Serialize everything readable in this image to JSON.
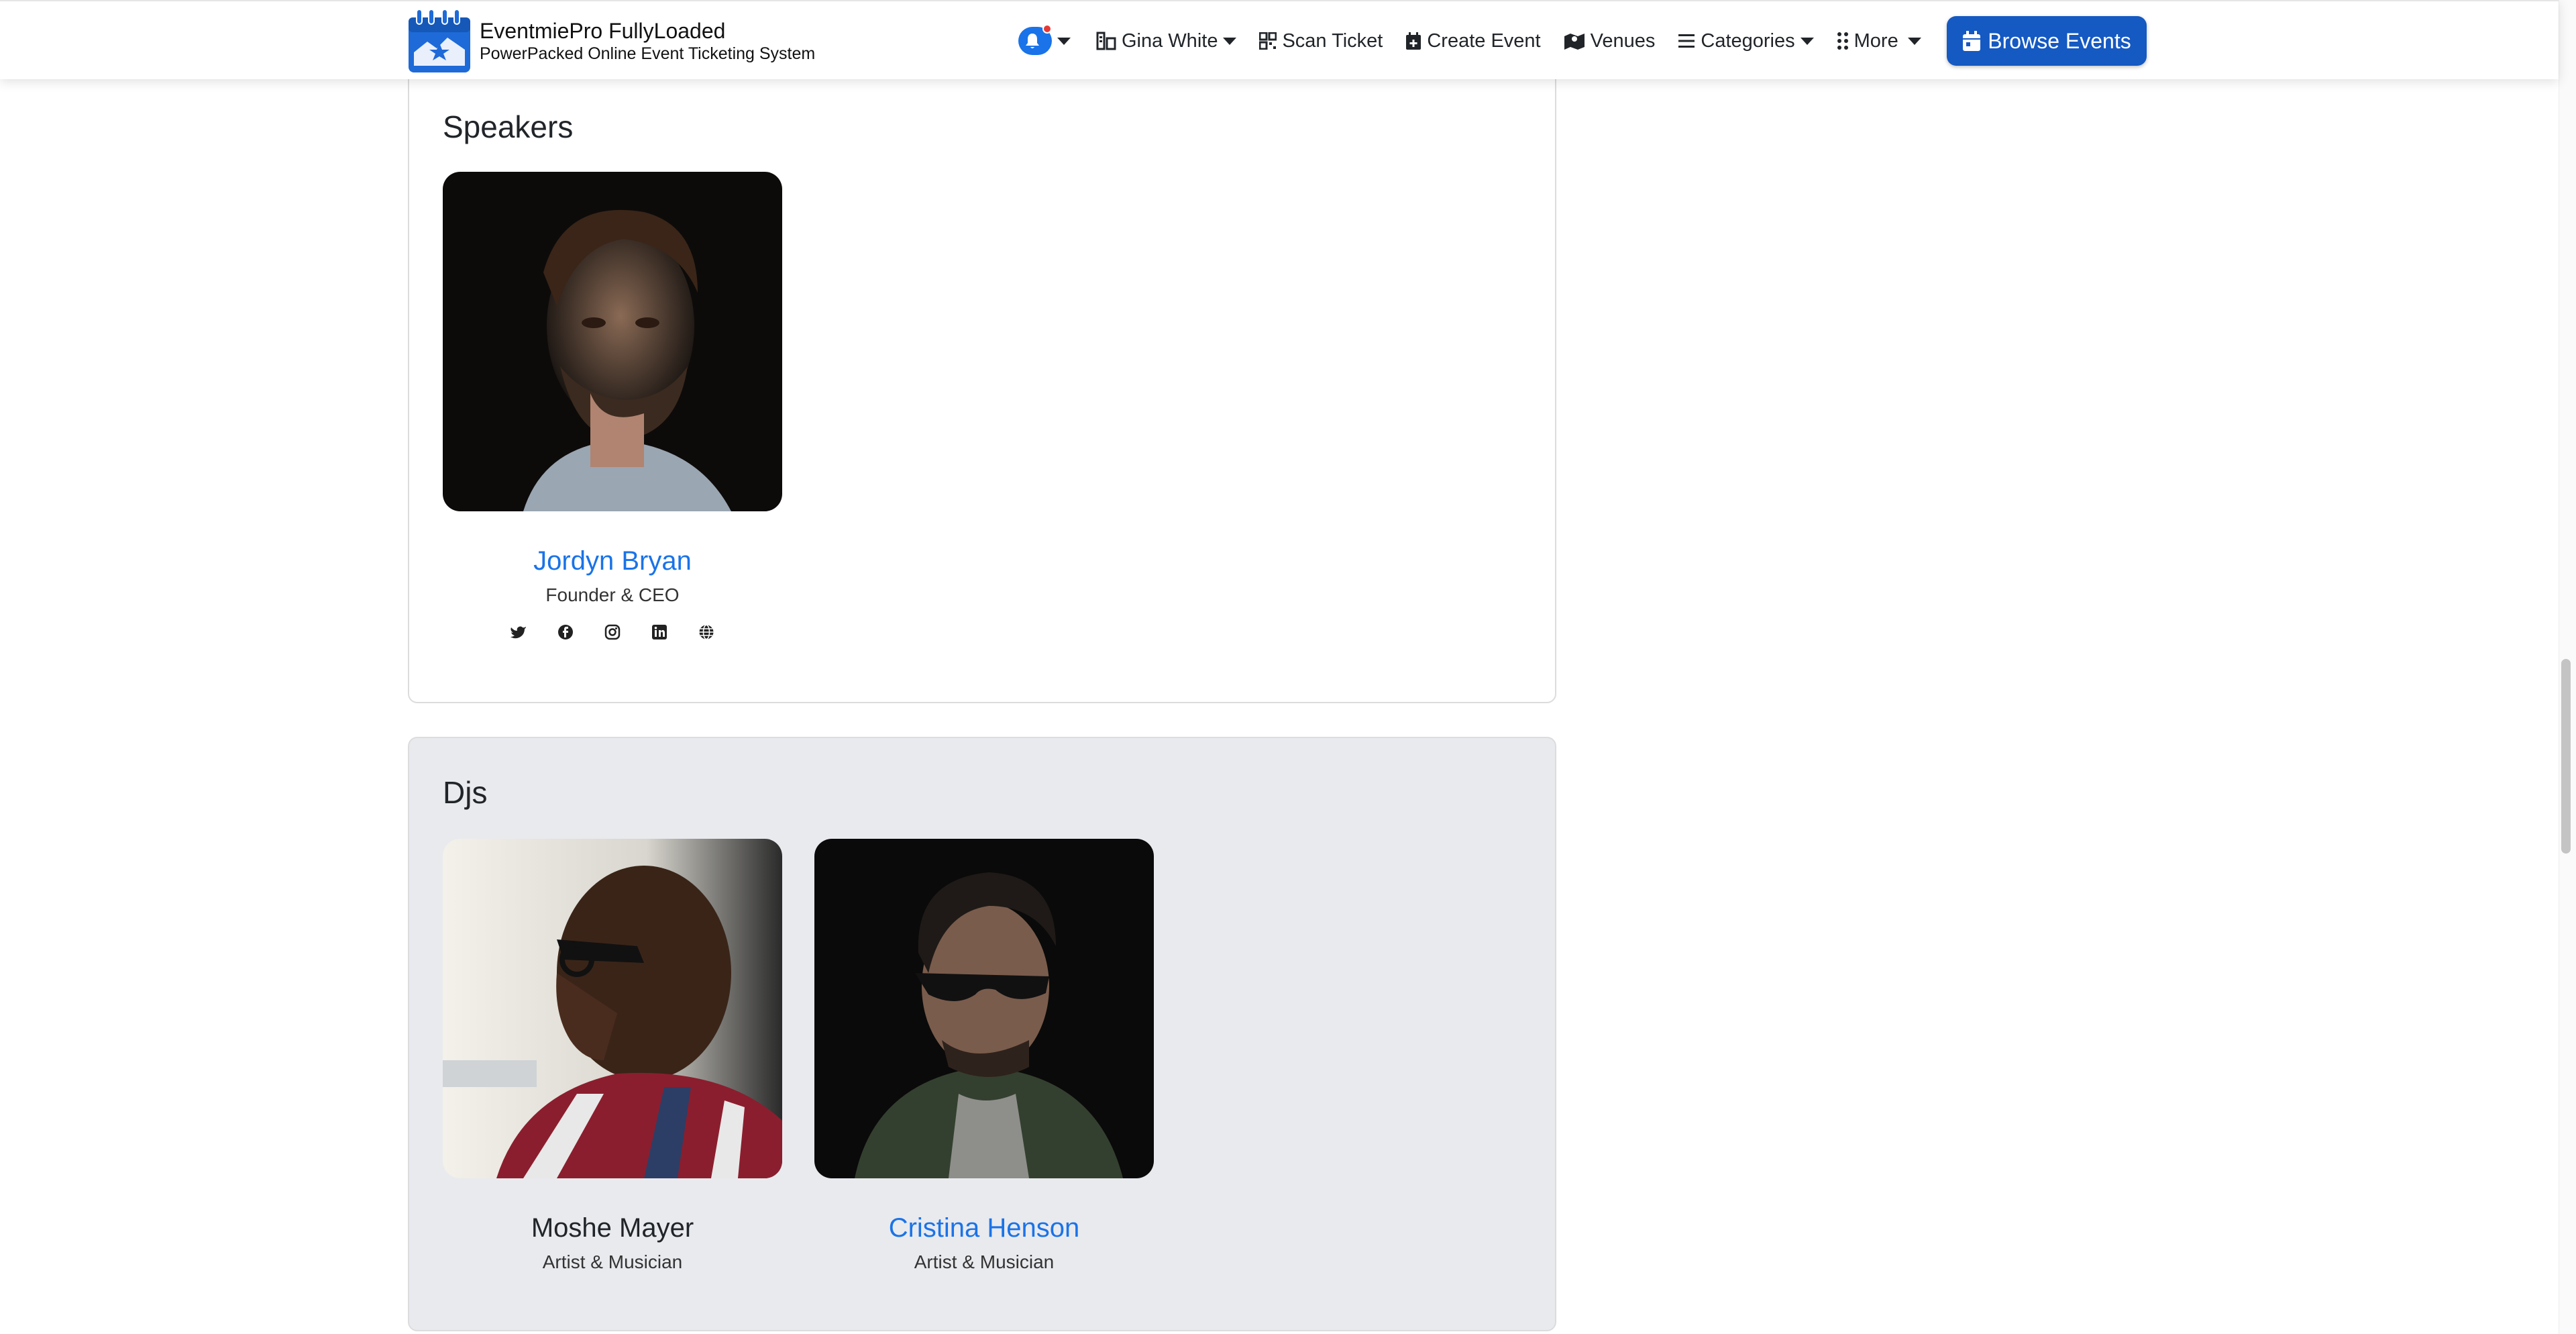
{
  "brand": {
    "title": "EventmiePro FullyLoaded",
    "subtitle": "PowerPacked Online Event Ticketing System"
  },
  "nav": {
    "user": "Gina White",
    "scan_ticket": "Scan Ticket",
    "create_event": "Create Event",
    "venues": "Venues",
    "categories": "Categories",
    "more": "More",
    "browse_events": "Browse Events"
  },
  "speakers": {
    "title": "Speakers",
    "people": [
      {
        "name": "Jordyn Bryan",
        "role": "Founder & CEO",
        "socials": [
          "twitter-icon",
          "facebook-icon",
          "instagram-icon",
          "linkedin-icon",
          "globe-icon"
        ]
      }
    ]
  },
  "djs": {
    "title": "Djs",
    "people": [
      {
        "name": "Moshe Mayer",
        "role": "Artist & Musician"
      },
      {
        "name": "Cristina Henson",
        "role": "Artist & Musician"
      }
    ]
  },
  "colors": {
    "accent": "#1a73e8",
    "button": "#1559c2",
    "notification_dot": "#e53935"
  }
}
